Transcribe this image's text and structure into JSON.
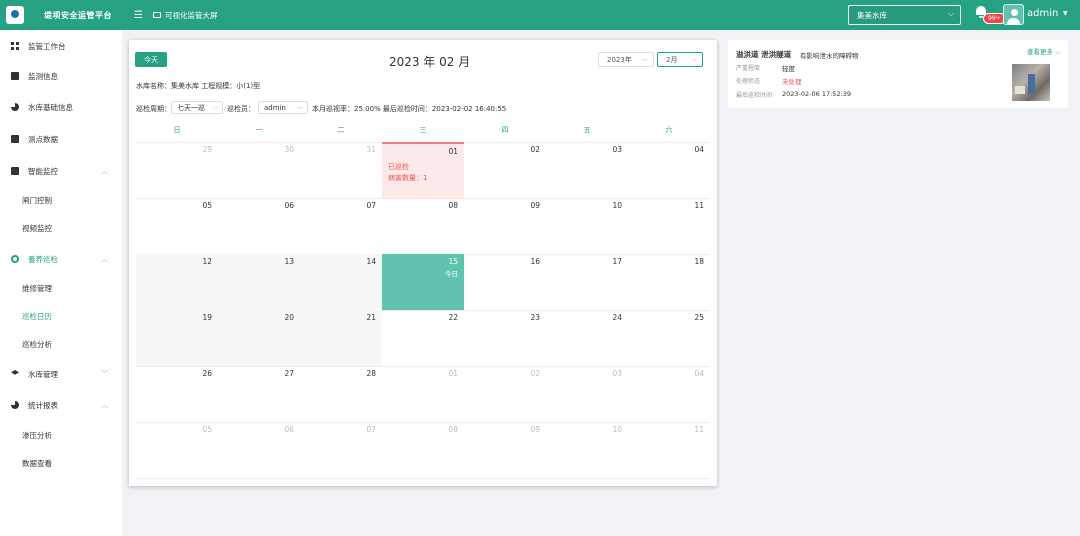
{
  "header": {
    "app_title": "堤坝安全运管平台",
    "bigscreen_label": "可视化监管大屏",
    "reservoir_select": "集美水库",
    "notifications": "99+",
    "username": "admin"
  },
  "sidebar": {
    "items": [
      {
        "label": "监管工作台"
      },
      {
        "label": "监测信息"
      },
      {
        "label": "水库基础信息"
      },
      {
        "label": "测点数据"
      },
      {
        "label": "智能监控",
        "children": [
          "闸门控制",
          "视频监控"
        ]
      },
      {
        "label": "養养巡检",
        "children": [
          "维修管理",
          "巡检日历",
          "巡检分析"
        ]
      },
      {
        "label": "水库管理"
      },
      {
        "label": "统计报表",
        "children": [
          "渗压分析",
          "数据查看"
        ]
      }
    ]
  },
  "calendar": {
    "today_button": "今天",
    "title": "2023 年 02 月",
    "year_select": "2023年",
    "month_select": "2月",
    "reservoir_info": "水库名称：集美水库  工程规模：小(1)型",
    "cycle_label": "巡检周期：",
    "cycle_value": "七天一巡",
    "inspector_label": "巡检员：",
    "inspector_value": "admin",
    "summary": "本月巡视率：25.00%  最后巡检时间：2023-02-02 16:40:55",
    "weekdays": [
      "日",
      "一",
      "二",
      "三",
      "四",
      "五",
      "六"
    ],
    "rows": [
      [
        "29",
        "30",
        "31",
        "01",
        "02",
        "03",
        "04"
      ],
      [
        "05",
        "06",
        "07",
        "08",
        "09",
        "10",
        "11"
      ],
      [
        "12",
        "13",
        "14",
        "15",
        "16",
        "17",
        "18"
      ],
      [
        "19",
        "20",
        "21",
        "22",
        "23",
        "24",
        "25"
      ],
      [
        "26",
        "27",
        "28",
        "01",
        "02",
        "03",
        "04"
      ],
      [
        "05",
        "06",
        "07",
        "08",
        "09",
        "10",
        "11"
      ]
    ],
    "event_status": "已巡检",
    "event_count": "病害数量：1",
    "today_label": "今日"
  },
  "issue_card": {
    "title": "溢洪道 泄洪隧道",
    "description": "有影响泄水的障碍物",
    "more": "查看更多",
    "severity_label": "严重程度",
    "severity_value": "轻度",
    "status_label": "处理状态",
    "status_value": "未处理",
    "time_label": "最后巡检时间",
    "time_value": "2023-02-06 17:52:39"
  },
  "colors": {
    "brand": "#26a283",
    "today_cell": "#5fc3ad",
    "event_bg": "#fce9e9",
    "alert": "#f05252"
  }
}
